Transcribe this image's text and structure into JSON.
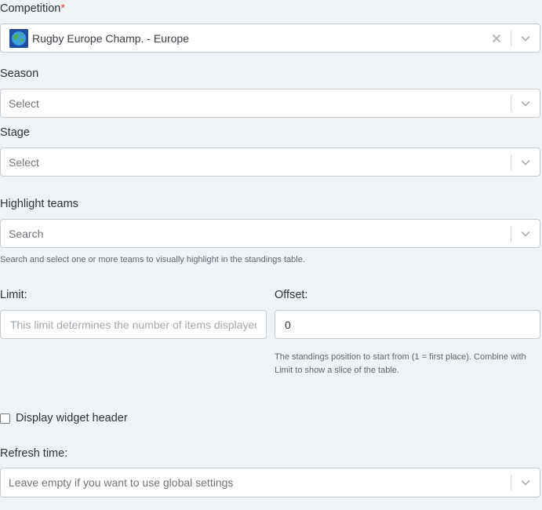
{
  "competition": {
    "label": "Competition",
    "required_mark": "*",
    "value": "Rugby Europe Champ. - Europe"
  },
  "season": {
    "label": "Season",
    "placeholder": "Select"
  },
  "stage": {
    "label": "Stage",
    "placeholder": "Select"
  },
  "highlight_teams": {
    "label": "Highlight teams",
    "placeholder": "Search",
    "help": "Search and select one or more teams to visually highlight in the standings table."
  },
  "limit": {
    "label": "Limit:",
    "placeholder": "This limit determines the number of items displayed"
  },
  "offset": {
    "label": "Offset:",
    "value": "0",
    "help": "The standings position to start from (1 = first place). Combine with Limit to show a slice of the table."
  },
  "display_header": {
    "label": "Display widget header",
    "checked": false
  },
  "refresh_time": {
    "label": "Refresh time:",
    "placeholder": "Leave empty if you want to use global settings"
  },
  "colors": {
    "required": "#d9534f",
    "border": "#c6ccd2",
    "background": "#f0f3f6"
  }
}
